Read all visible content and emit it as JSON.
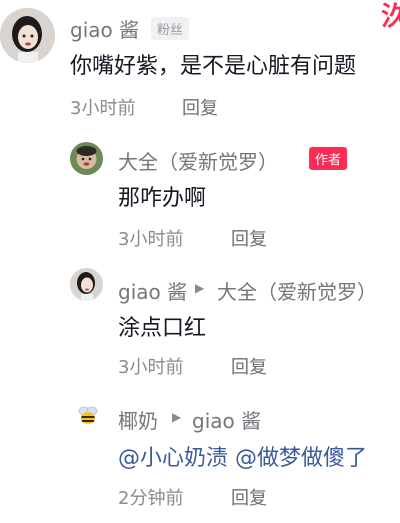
{
  "comments": [
    {
      "author": "giao 酱",
      "badge": "粉丝",
      "text": "你嘴好紫，是不是心脏有问题",
      "time": "3小时前",
      "reply_label": "回复"
    },
    {
      "author": "大全（爱新觉罗）",
      "badge": "作者",
      "text": "那咋办啊",
      "time": "3小时前",
      "reply_label": "回复"
    },
    {
      "author": "giao 酱",
      "reply_to": "大全（爱新觉罗）",
      "text": "涂点口红",
      "time": "3小时前",
      "reply_label": "回复"
    },
    {
      "author": "椰奶",
      "reply_to": "giao 酱",
      "mention_1": "@小心奶渍",
      "mention_2": "@做梦做傻了",
      "time": "2分钟前",
      "reply_label": "回复"
    }
  ],
  "corner_mark": "汣",
  "colors": {
    "author_tag": "#fe2c55",
    "mention": "#3a5a9a"
  }
}
